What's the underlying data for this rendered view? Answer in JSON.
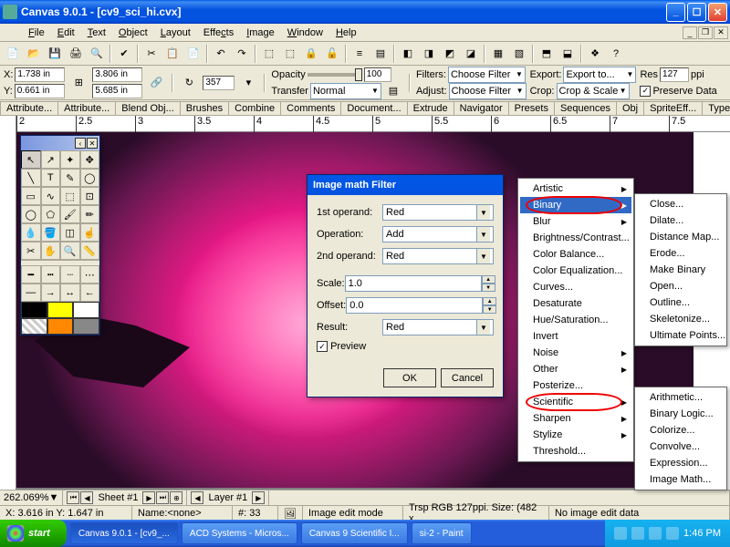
{
  "window": {
    "title": "Canvas 9.0.1 - [cv9_sci_hi.cvx]"
  },
  "menu": {
    "items": [
      "File",
      "Edit",
      "Text",
      "Object",
      "Layout",
      "Effects",
      "Image",
      "Window",
      "Help"
    ]
  },
  "props": {
    "x": "1.738 in",
    "y": "0.661 in",
    "w": "3.806 in",
    "h": "5.685 in",
    "rotate": "357",
    "opacity": "100",
    "transfer": "Normal",
    "filters_lbl": "Filters:",
    "filters_val": "Choose Filter",
    "adjust_lbl": "Adjust:",
    "adjust_val": "Choose Filter",
    "export_lbl": "Export:",
    "export_val": "Export to...",
    "crop_lbl": "Crop:",
    "crop_val": "Crop & Scale",
    "res_lbl": "Res",
    "res_val": "127",
    "res_unit": "ppi",
    "preserve": "Preserve Data",
    "opacity_lbl": "Opacity",
    "transfer_lbl": "Transfer"
  },
  "tabs": [
    "Attribute...",
    "Attribute...",
    "Blend Obj...",
    "Brushes",
    "Combine",
    "Comments",
    "Document...",
    "Extrude",
    "Navigator",
    "Presets",
    "Sequences",
    "Obj",
    "SpriteEff...",
    "Type"
  ],
  "ruler": {
    "ticks": [
      "2",
      "2.5",
      "3",
      "3.5",
      "4",
      "4.5",
      "5",
      "5.5",
      "6",
      "6.5",
      "7",
      "7.5"
    ]
  },
  "dialog": {
    "title": "Image math Filter",
    "op1_lbl": "1st operand:",
    "op1_val": "Red",
    "oper_lbl": "Operation:",
    "oper_val": "Add",
    "op2_lbl": "2nd operand:",
    "op2_val": "Red",
    "scale_lbl": "Scale:",
    "scale_val": "1.0",
    "offset_lbl": "Offset:",
    "offset_val": "0.0",
    "result_lbl": "Result:",
    "result_val": "Red",
    "preview": "Preview",
    "ok": "OK",
    "cancel": "Cancel"
  },
  "menu1": {
    "items": [
      "Artistic",
      "Binary",
      "Blur",
      "Brightness/Contrast...",
      "Color Balance...",
      "Color Equalization...",
      "Curves...",
      "Desaturate",
      "Hue/Saturation...",
      "Invert",
      "Noise",
      "Other",
      "Posterize...",
      "Scientific",
      "Sharpen",
      "Stylize",
      "Threshold..."
    ],
    "subs": [
      true,
      true,
      true,
      false,
      false,
      false,
      false,
      false,
      false,
      false,
      true,
      true,
      false,
      true,
      true,
      true,
      false
    ],
    "hi": 1,
    "circled": [
      1,
      13
    ]
  },
  "menu2": {
    "items": [
      "Close...",
      "Dilate...",
      "Distance Map...",
      "Erode...",
      "Make Binary",
      "Open...",
      "Outline...",
      "Skeletonize...",
      "Ultimate Points..."
    ]
  },
  "menu3": {
    "items": [
      "Arithmetic...",
      "Binary Logic...",
      "Colorize...",
      "Convolve...",
      "Expression...",
      "Image Math..."
    ]
  },
  "docstatus": {
    "zoom": "262.069%",
    "sheet": "Sheet #1",
    "layer": "Layer #1"
  },
  "appstatus": {
    "xy": "X: 3.616 in   Y: 1.647 in",
    "name": "Name:<none>",
    "num": "#: 33",
    "mode": "Image edit mode",
    "info": "Trsp RGB 127ppi. Size: (482 x",
    "edit": "No image edit data"
  },
  "taskbar": {
    "start": "start",
    "tasks": [
      "Canvas 9.0.1 - [cv9_...",
      "ACD Systems - Micros...",
      "Canvas 9 Scientific I...",
      "si-2 - Paint"
    ],
    "time": "1:46 PM"
  }
}
